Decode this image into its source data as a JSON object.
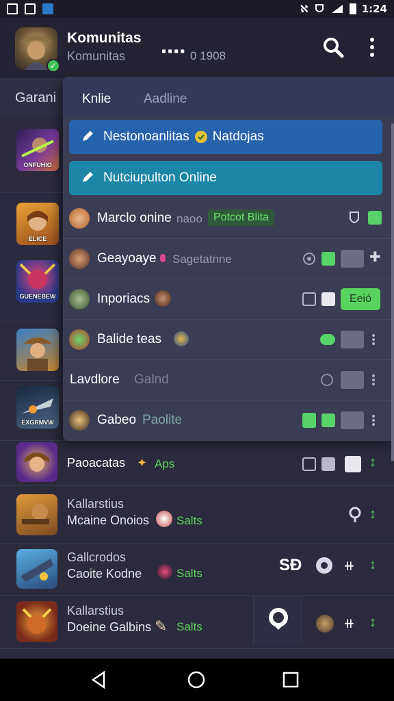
{
  "status_bar": {
    "time": "1:24",
    "network": "ℵ"
  },
  "header": {
    "title": "Komunitas",
    "subtitle": "Komunitas",
    "dots": "▪▪▪▪",
    "count": "0 1908"
  },
  "background_section": {
    "label": "Garani"
  },
  "background_thumbs": [
    {
      "caption": "ONFUHIO"
    },
    {
      "caption": "ELICE"
    },
    {
      "caption": "GUENEBEW"
    },
    {
      "caption": ""
    },
    {
      "caption": "EXGRMVW"
    }
  ],
  "panel": {
    "tabs": [
      {
        "label": "Knlie"
      },
      {
        "label": "Aadline"
      }
    ],
    "pill_blue": {
      "label": "Nestonoanlitas",
      "label2": "Natdojas"
    },
    "pill_teal": {
      "label": "Nutciupulton Online"
    },
    "rows": [
      {
        "name": "Marclo onine",
        "extra": "naoo",
        "badge": "Potcot Blita"
      },
      {
        "name": "Geayoaye",
        "extra": "Sagetatnne"
      },
      {
        "name": "Inporiacs",
        "button": "Eeió"
      },
      {
        "name": "Balide teas"
      },
      {
        "name": "Lavdlore",
        "extra": "Galnd"
      },
      {
        "name": "Gabeo",
        "extra": "Paolite"
      }
    ]
  },
  "list_rows": [
    {
      "title": "Paoacatas",
      "tag": "Aps"
    },
    {
      "title": "Kallarstius",
      "line2": "Mcaine Onoios",
      "tag": "Salts"
    },
    {
      "title": "Gallcrodos",
      "line2": "Caoite Kodne",
      "tag": "Salts",
      "mark": "SĐ"
    },
    {
      "title": "Kallarstius",
      "line2": "Doeine Galbins",
      "tag": "Salts"
    }
  ],
  "colors": {
    "accent_blue": "#2663ad",
    "accent_teal": "#1d86a6",
    "online_green": "#5ad35e"
  }
}
